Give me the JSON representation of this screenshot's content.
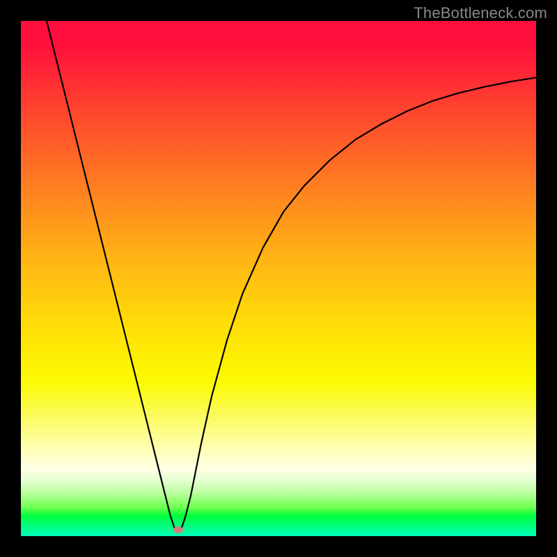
{
  "watermark": "TheBottleneck.com",
  "chart_data": {
    "type": "line",
    "title": "",
    "xlabel": "",
    "ylabel": "",
    "xlim": [
      0,
      100
    ],
    "ylim": [
      0,
      100
    ],
    "legend": false,
    "grid": false,
    "background": "rainbow-vertical-gradient (red high → green low bottleneck)",
    "marker": {
      "x": 30.5,
      "y": 1.2,
      "color": "#d47e7a"
    },
    "series": [
      {
        "name": "bottleneck-curve",
        "color": "#000000",
        "x": [
          5,
          7,
          9,
          11,
          13,
          15,
          17,
          19,
          21,
          23,
          25,
          27,
          28,
          29,
          30,
          31,
          32,
          33,
          34,
          35,
          37,
          40,
          43,
          47,
          51,
          55,
          60,
          65,
          70,
          75,
          80,
          85,
          90,
          95,
          100
        ],
        "y": [
          100,
          92,
          84,
          76,
          68,
          60,
          52,
          44,
          36,
          28,
          20,
          12,
          8,
          4,
          1,
          1,
          4,
          8,
          13,
          18,
          27,
          38,
          47,
          56,
          63,
          68,
          73,
          77,
          80,
          82.5,
          84.5,
          86,
          87.2,
          88.2,
          89
        ]
      }
    ]
  }
}
